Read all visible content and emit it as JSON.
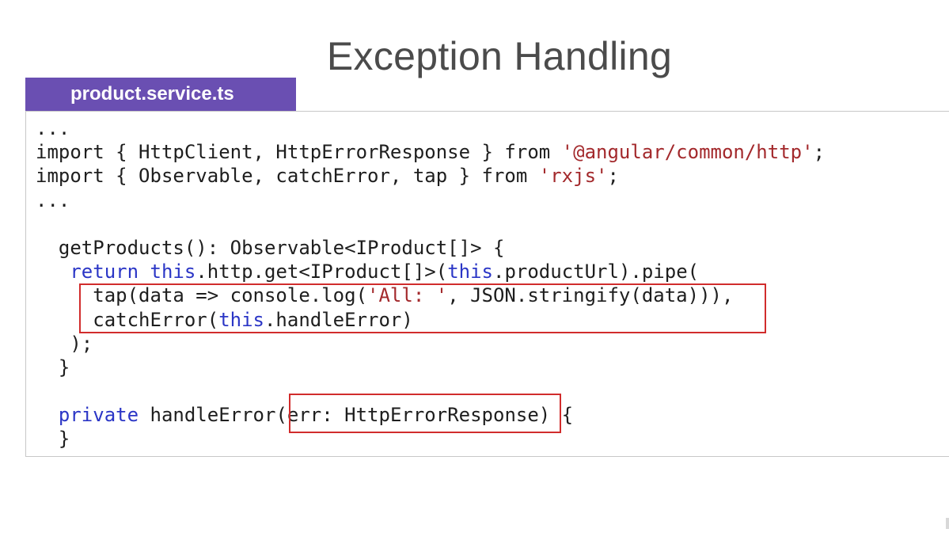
{
  "slide": {
    "title": "Exception Handling"
  },
  "file_tab": {
    "label": "product.service.ts"
  },
  "code": {
    "lines": [
      [
        {
          "t": "..."
        }
      ],
      [
        {
          "t": "import { HttpClient, HttpErrorResponse } from "
        },
        {
          "t": "'@angular/common/http'",
          "c": "str"
        },
        {
          "t": ";"
        }
      ],
      [
        {
          "t": "import { Observable, catchError, tap } from "
        },
        {
          "t": "'rxjs'",
          "c": "str"
        },
        {
          "t": ";"
        }
      ],
      [
        {
          "t": "..."
        }
      ],
      [
        {
          "t": ""
        }
      ],
      [
        {
          "t": "  getProducts(): Observable<IProduct[]> {"
        }
      ],
      [
        {
          "t": "   "
        },
        {
          "t": "return",
          "c": "kw"
        },
        {
          "t": " "
        },
        {
          "t": "this",
          "c": "kw"
        },
        {
          "t": ".http.get<IProduct[]>("
        },
        {
          "t": "this",
          "c": "kw"
        },
        {
          "t": ".productUrl).pipe("
        }
      ],
      [
        {
          "t": "     tap(data => console.log("
        },
        {
          "t": "'All: '",
          "c": "str"
        },
        {
          "t": ", JSON.stringify(data))),"
        }
      ],
      [
        {
          "t": "     catchError("
        },
        {
          "t": "this",
          "c": "kw"
        },
        {
          "t": ".handleError)"
        }
      ],
      [
        {
          "t": "   );"
        }
      ],
      [
        {
          "t": "  }"
        }
      ],
      [
        {
          "t": ""
        }
      ],
      [
        {
          "t": "  "
        },
        {
          "t": "private",
          "c": "kw"
        },
        {
          "t": " handleError(err: HttpErrorResponse) {"
        }
      ],
      [
        {
          "t": "  }"
        }
      ]
    ]
  },
  "colors": {
    "tab_background": "#6a4fb2",
    "keyword": "#2b36c6",
    "string": "#a3292c",
    "highlight_border": "#d12c2c"
  }
}
